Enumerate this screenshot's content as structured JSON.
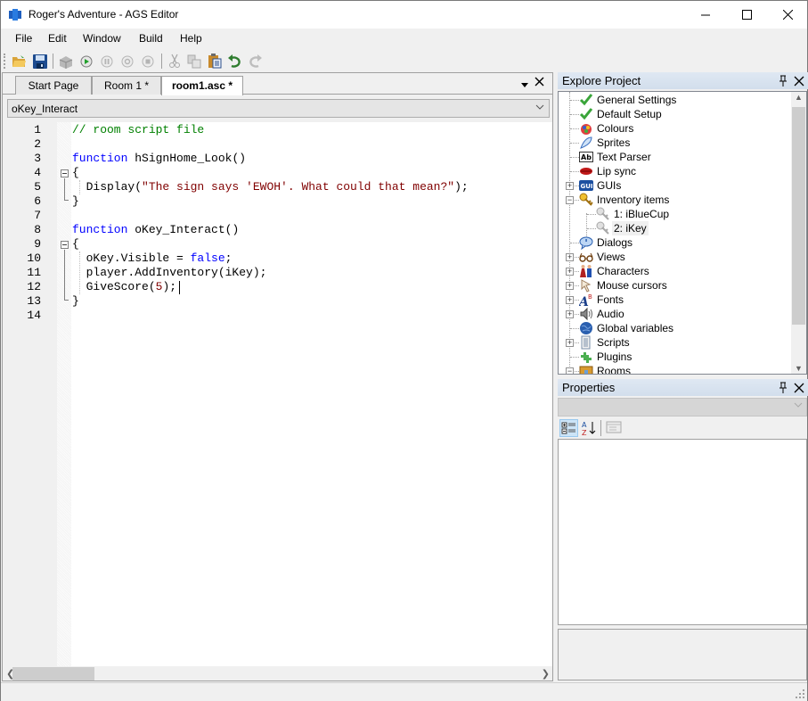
{
  "window": {
    "title": "Roger's Adventure - AGS Editor",
    "controls": [
      "minimize",
      "maximize",
      "close"
    ]
  },
  "menu": {
    "items": [
      "File",
      "Edit",
      "Window",
      "Build",
      "Help"
    ]
  },
  "toolbar": {
    "buttons": [
      {
        "name": "open-project",
        "icon": "folder-open-icon",
        "enabled": true
      },
      {
        "name": "save",
        "icon": "floppy-disk-icon",
        "enabled": true
      },
      {
        "name": "build-exe",
        "icon": "build-icon",
        "enabled": false
      },
      {
        "name": "run",
        "icon": "play-icon",
        "enabled": true
      },
      {
        "name": "pause",
        "icon": "pause-icon",
        "enabled": false
      },
      {
        "name": "step",
        "icon": "step-icon",
        "enabled": false
      },
      {
        "name": "stop",
        "icon": "stop-icon",
        "enabled": false
      },
      {
        "name": "cut",
        "icon": "scissors-icon",
        "enabled": false
      },
      {
        "name": "copy",
        "icon": "copy-icon",
        "enabled": false
      },
      {
        "name": "paste",
        "icon": "paste-icon",
        "enabled": true
      },
      {
        "name": "undo",
        "icon": "undo-icon",
        "enabled": true
      },
      {
        "name": "redo",
        "icon": "redo-icon",
        "enabled": false
      }
    ]
  },
  "document": {
    "tabs": [
      {
        "label": "Start Page",
        "active": false
      },
      {
        "label": "Room 1 *",
        "active": false
      },
      {
        "label": "room1.asc *",
        "active": true
      }
    ],
    "function_selector": "oKey_Interact",
    "code_lines": [
      {
        "num": "1",
        "text": "// room script file"
      },
      {
        "num": "2",
        "text": ""
      },
      {
        "num": "3",
        "text": "function hSignHome_Look()"
      },
      {
        "num": "4",
        "text": "{"
      },
      {
        "num": "5",
        "text": "  Display(\"The sign says 'EWOH'. What could that mean?\");"
      },
      {
        "num": "6",
        "text": "}"
      },
      {
        "num": "7",
        "text": ""
      },
      {
        "num": "8",
        "text": "function oKey_Interact()"
      },
      {
        "num": "9",
        "text": "{"
      },
      {
        "num": "10",
        "text": "  oKey.Visible = false;"
      },
      {
        "num": "11",
        "text": "  player.AddInventory(iKey);"
      },
      {
        "num": "12",
        "text": "  GiveScore(5);"
      },
      {
        "num": "13",
        "text": "}"
      },
      {
        "num": "14",
        "text": ""
      }
    ],
    "tokens": {
      "comment": "// room script file",
      "kw_function": "function",
      "fn1": " hSignHome_Look()",
      "brace_open": "{",
      "brace_close": "}",
      "display_call": "  Display(",
      "display_str": "\"The sign says 'EWOH'. What could that mean?\"",
      "display_end": ");",
      "fn2": " oKey_Interact()",
      "l10_a": "  oKey.Visible = ",
      "l10_kw": "false",
      "l10_b": ";",
      "l11": "  player.AddInventory(iKey);",
      "l12_a": "  GiveScore(",
      "l12_num": "5",
      "l12_b": ");"
    }
  },
  "explore_project": {
    "title": "Explore Project",
    "items": [
      {
        "label": "General Settings",
        "icon": "checkmark-icon",
        "expander": null,
        "level": 0
      },
      {
        "label": "Default Setup",
        "icon": "checkmark-icon",
        "expander": null,
        "level": 0
      },
      {
        "label": "Colours",
        "icon": "palette-icon",
        "expander": null,
        "level": 0
      },
      {
        "label": "Sprites",
        "icon": "sprite-icon",
        "expander": null,
        "level": 0
      },
      {
        "label": "Text Parser",
        "icon": "text-parser-icon",
        "expander": null,
        "level": 0
      },
      {
        "label": "Lip sync",
        "icon": "lips-icon",
        "expander": null,
        "level": 0
      },
      {
        "label": "GUIs",
        "icon": "gui-icon",
        "expander": "+",
        "level": 0
      },
      {
        "label": "Inventory items",
        "icon": "key-icon",
        "expander": "-",
        "level": 0
      },
      {
        "label": "1: iBlueCup",
        "icon": "inventory-item-icon",
        "expander": null,
        "level": 1
      },
      {
        "label": "2: iKey",
        "icon": "inventory-item-icon",
        "expander": null,
        "level": 1,
        "selected": true
      },
      {
        "label": "Dialogs",
        "icon": "speech-bubble-icon",
        "expander": null,
        "level": 0
      },
      {
        "label": "Views",
        "icon": "glasses-icon",
        "expander": "+",
        "level": 0
      },
      {
        "label": "Characters",
        "icon": "characters-icon",
        "expander": "+",
        "level": 0
      },
      {
        "label": "Mouse cursors",
        "icon": "cursor-icon",
        "expander": "+",
        "level": 0
      },
      {
        "label": "Fonts",
        "icon": "font-icon",
        "expander": "+",
        "level": 0
      },
      {
        "label": "Audio",
        "icon": "speaker-icon",
        "expander": "+",
        "level": 0
      },
      {
        "label": "Global variables",
        "icon": "globe-icon",
        "expander": null,
        "level": 0
      },
      {
        "label": "Scripts",
        "icon": "script-icon",
        "expander": "+",
        "level": 0
      },
      {
        "label": "Plugins",
        "icon": "puzzle-icon",
        "expander": null,
        "level": 0
      },
      {
        "label": "Rooms",
        "icon": "room-icon",
        "expander": "-",
        "level": 0
      }
    ]
  },
  "properties": {
    "title": "Properties",
    "selected_object": "",
    "toolbar": [
      "categorized-icon",
      "alphabetical-icon",
      "property-pages-icon"
    ]
  },
  "colors": {
    "keyword": "#0000ff",
    "comment": "#008000",
    "string": "#800000",
    "panel_header": "#d8e2ee"
  }
}
